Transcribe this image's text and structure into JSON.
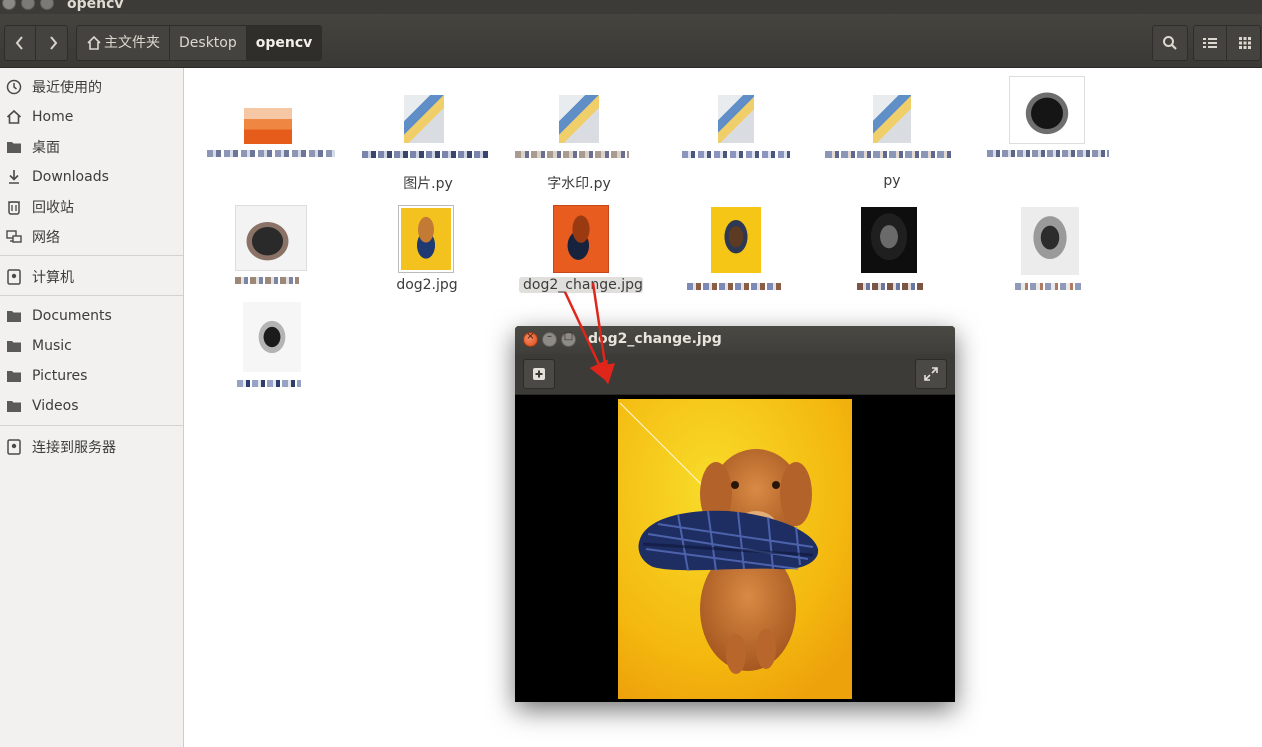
{
  "window": {
    "title": "opencv"
  },
  "toolbar": {
    "back_icon": "chevron-left-icon",
    "forward_icon": "chevron-right-icon",
    "breadcrumbs": [
      {
        "label": "主文件夹",
        "icon": "home-icon"
      },
      {
        "label": "Desktop"
      },
      {
        "label": "opencv"
      }
    ],
    "search_icon": "search-icon",
    "list_view_icon": "list-view-icon",
    "grid_view_icon": "grid-view-icon"
  },
  "sidebar": {
    "items": [
      {
        "label": "最近使用的",
        "icon": "clock-icon"
      },
      {
        "label": "Home",
        "icon": "home-icon"
      },
      {
        "label": "桌面",
        "icon": "folder-icon"
      },
      {
        "label": "Downloads",
        "icon": "download-icon"
      },
      {
        "label": "回收站",
        "icon": "trash-icon"
      },
      {
        "label": "网络",
        "icon": "network-icon"
      },
      {
        "label": "计算机",
        "icon": "drive-icon"
      },
      {
        "label": "Documents",
        "icon": "folder-icon"
      },
      {
        "label": "Music",
        "icon": "folder-icon"
      },
      {
        "label": "Pictures",
        "icon": "folder-icon"
      },
      {
        "label": "Videos",
        "icon": "folder-icon"
      },
      {
        "label": "连接到服务器",
        "icon": "server-icon"
      }
    ]
  },
  "files": {
    "row1_partial_labels": [
      "图片.py",
      "字水印.py",
      "py"
    ],
    "dog2": "dog2.jpg",
    "dog2_change": "dog2_change.jpg"
  },
  "viewer": {
    "title": "dog2_change.jpg",
    "add_icon": "add-icon",
    "fullscreen_icon": "fullscreen-icon",
    "image_name": "golden-retriever-holding-slipper-photo"
  },
  "colors": {
    "annotation_arrow": "#e0251b",
    "selection_orange": "#e85d1f",
    "sidebar_bg": "#f2f1f0",
    "toolbar_bg": "#3c3b37"
  }
}
